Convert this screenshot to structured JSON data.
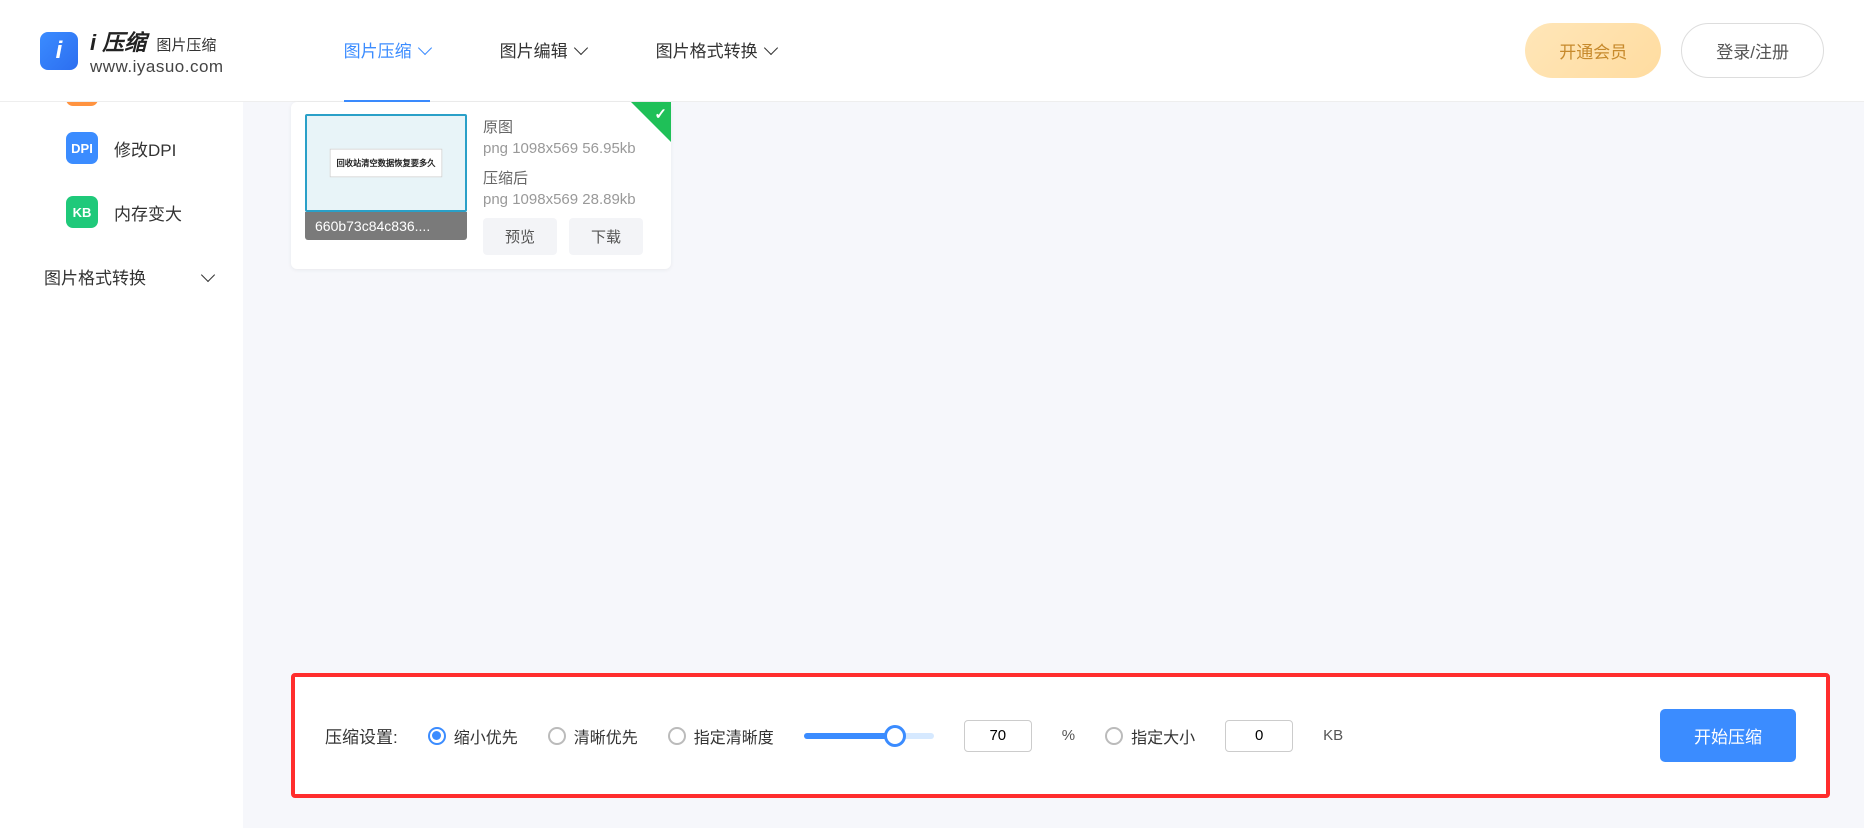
{
  "header": {
    "logo_title": "i 压缩",
    "logo_sub": "图片压缩",
    "logo_url": "www.iyasuo.com",
    "nav": [
      {
        "label": "图片压缩",
        "active": true
      },
      {
        "label": "图片编辑",
        "active": false
      },
      {
        "label": "图片格式转换",
        "active": false
      }
    ],
    "vip_button": "开通会员",
    "login_button": "登录/注册"
  },
  "sidebar": {
    "items": [
      {
        "label": "修改DPI",
        "icon_text": "DPI",
        "icon_cls": "blue"
      },
      {
        "label": "内存变大",
        "icon_text": "KB",
        "icon_cls": "green"
      }
    ],
    "group_label": "图片格式转换"
  },
  "file": {
    "filename": "660b73c84c836....",
    "thumb_text": "回收站清空数据恢复要多久",
    "orig_label": "原图",
    "orig_info": "png  1098x569  56.95kb",
    "comp_label": "压缩后",
    "comp_info": "png  1098x569  28.89kb",
    "preview_btn": "预览",
    "download_btn": "下载"
  },
  "settings": {
    "label": "压缩设置:",
    "opt_shrink": "缩小优先",
    "opt_clear": "清晰优先",
    "opt_quality": "指定清晰度",
    "quality_value": "70",
    "quality_unit": "%",
    "opt_size": "指定大小",
    "size_value": "0",
    "size_unit": "KB",
    "start_btn": "开始压缩"
  }
}
